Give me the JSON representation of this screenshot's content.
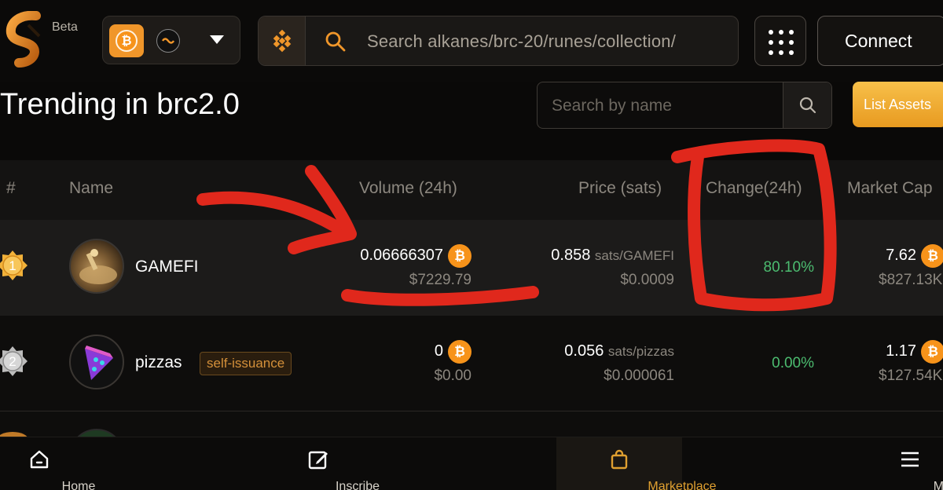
{
  "header": {
    "beta_label": "Beta",
    "search_placeholder": "Search alkanes/brc-20/runes/collection/",
    "connect_label": "Connect"
  },
  "page": {
    "title": "Trending in brc2.0",
    "name_search_placeholder": "Search by name",
    "list_assets_label": "List Assets"
  },
  "table": {
    "headers": {
      "rank": "#",
      "name": "Name",
      "volume": "Volume (24h)",
      "price": "Price (sats)",
      "change": "Change(24h)",
      "market_cap": "Market Cap"
    },
    "rows": [
      {
        "rank": "1",
        "name": "GAMEFI",
        "volume_btc": "0.06666307",
        "volume_usd": "$7229.79",
        "price_value": "0.858",
        "price_unit": "sats/GAMEFI",
        "price_usd": "$0.0009",
        "change": "80.10%",
        "market_cap_btc": "7.62",
        "market_cap_usd": "$827.13K"
      },
      {
        "rank": "2",
        "name": "pizzas",
        "tag": "self-issuance",
        "volume_btc": "0",
        "volume_usd": "$0.00",
        "price_value": "0.056",
        "price_unit": "sats/pizzas",
        "price_usd": "$0.000061",
        "change": "0.00%",
        "market_cap_btc": "1.17",
        "market_cap_usd": "$127.54K"
      }
    ]
  },
  "bottom_nav": {
    "items": [
      {
        "label": "Home",
        "icon": "home-icon"
      },
      {
        "label": "Inscribe",
        "icon": "edit-icon"
      },
      {
        "label": "Marketplace",
        "icon": "shopping-bag-icon",
        "active": true
      },
      {
        "label": "More",
        "icon": "menu-icon"
      }
    ]
  },
  "colors": {
    "accent": "#f0962a",
    "positive": "#4cbc70",
    "annotation": "#e0281c"
  }
}
